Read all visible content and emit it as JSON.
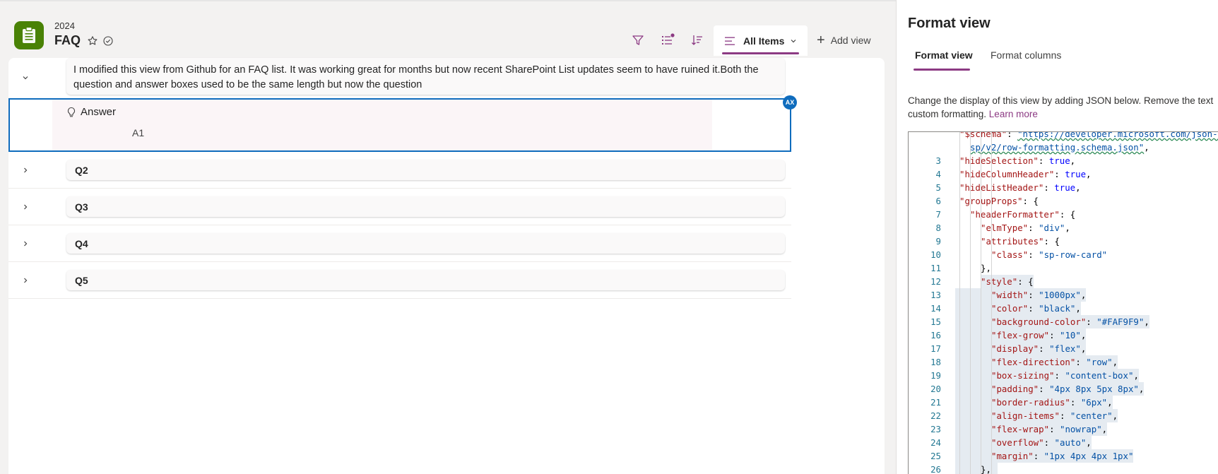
{
  "header": {
    "year": "2024",
    "list_title": "FAQ"
  },
  "commands": {
    "active_view_label": "All Items",
    "add_view_label": "Add view"
  },
  "list": {
    "expanded_item": {
      "question": "I modified this view from Github for an FAQ list. It was working great for months but now recent SharePoint List updates seem to have ruined it.Both the question and answer boxes used to be the same length but now the question",
      "answer_label": "Answer",
      "answer_value": "A1"
    },
    "collapsed_items": [
      {
        "label": "Q2"
      },
      {
        "label": "Q3"
      },
      {
        "label": "Q4"
      },
      {
        "label": "Q5"
      }
    ],
    "badge_label": "AX"
  },
  "format_pane": {
    "title": "Format view",
    "tabs": [
      {
        "label": "Format view",
        "active": true
      },
      {
        "label": "Format columns",
        "active": false
      }
    ],
    "description_line1": "Change the display of this view by adding JSON below. Remove the text",
    "description_line2": "custom formatting. ",
    "learn_more": "Learn more",
    "code_lines": [
      {
        "n": "",
        "indent": 1,
        "text": "\"$schema\": \"https://developer.microsoft.com/json-schemas/"
      },
      {
        "n": "",
        "indent": 2,
        "text": "sp/v2/row-formatting.schema.json\","
      },
      {
        "n": "3",
        "indent": 1,
        "text": "\"hideSelection\": true,"
      },
      {
        "n": "4",
        "indent": 1,
        "text": "\"hideColumnHeader\": true,"
      },
      {
        "n": "5",
        "indent": 1,
        "text": "\"hideListHeader\": true,"
      },
      {
        "n": "6",
        "indent": 1,
        "text": "\"groupProps\": {"
      },
      {
        "n": "7",
        "indent": 2,
        "text": "\"headerFormatter\": {"
      },
      {
        "n": "8",
        "indent": 3,
        "text": "\"elmType\": \"div\","
      },
      {
        "n": "9",
        "indent": 3,
        "text": "\"attributes\": {"
      },
      {
        "n": "10",
        "indent": 4,
        "text": "\"class\": \"sp-row-card\""
      },
      {
        "n": "11",
        "indent": 3,
        "text": "},"
      },
      {
        "n": "12",
        "indent": 3,
        "text": "\"style\": {"
      },
      {
        "n": "13",
        "indent": 4,
        "text": "\"width\": \"1000px\","
      },
      {
        "n": "14",
        "indent": 4,
        "text": "\"color\": \"black\","
      },
      {
        "n": "15",
        "indent": 4,
        "text": "\"background-color\": \"#FAF9F9\","
      },
      {
        "n": "16",
        "indent": 4,
        "text": "\"flex-grow\": \"10\","
      },
      {
        "n": "17",
        "indent": 4,
        "text": "\"display\": \"flex\","
      },
      {
        "n": "18",
        "indent": 4,
        "text": "\"flex-direction\": \"row\","
      },
      {
        "n": "19",
        "indent": 4,
        "text": "\"box-sizing\": \"content-box\","
      },
      {
        "n": "20",
        "indent": 4,
        "text": "\"padding\": \"4px 8px 5px 8px\","
      },
      {
        "n": "21",
        "indent": 4,
        "text": "\"border-radius\": \"6px\","
      },
      {
        "n": "22",
        "indent": 4,
        "text": "\"align-items\": \"center\","
      },
      {
        "n": "23",
        "indent": 4,
        "text": "\"flex-wrap\": \"nowrap\","
      },
      {
        "n": "24",
        "indent": 4,
        "text": "\"overflow\": \"auto\","
      },
      {
        "n": "25",
        "indent": 4,
        "text": "\"margin\": \"1px 4px 4px 1px\""
      },
      {
        "n": "26",
        "indent": 3,
        "text": "},"
      }
    ]
  },
  "colors": {
    "accent": "#8c3a83",
    "focus_border": "#0f6cbd",
    "app_icon": "#498205",
    "card_bg": "#FAF9F9",
    "answer_bg": "#fbf5f7"
  },
  "icons": {
    "app": "clipboard-icon",
    "star": "star-icon",
    "follow": "check-circle-icon",
    "filter": "filter-icon",
    "group": "group-list-icon",
    "sort": "sort-icon",
    "view": "list-view-icon",
    "add": "plus-icon",
    "answer": "lightbulb-icon"
  }
}
